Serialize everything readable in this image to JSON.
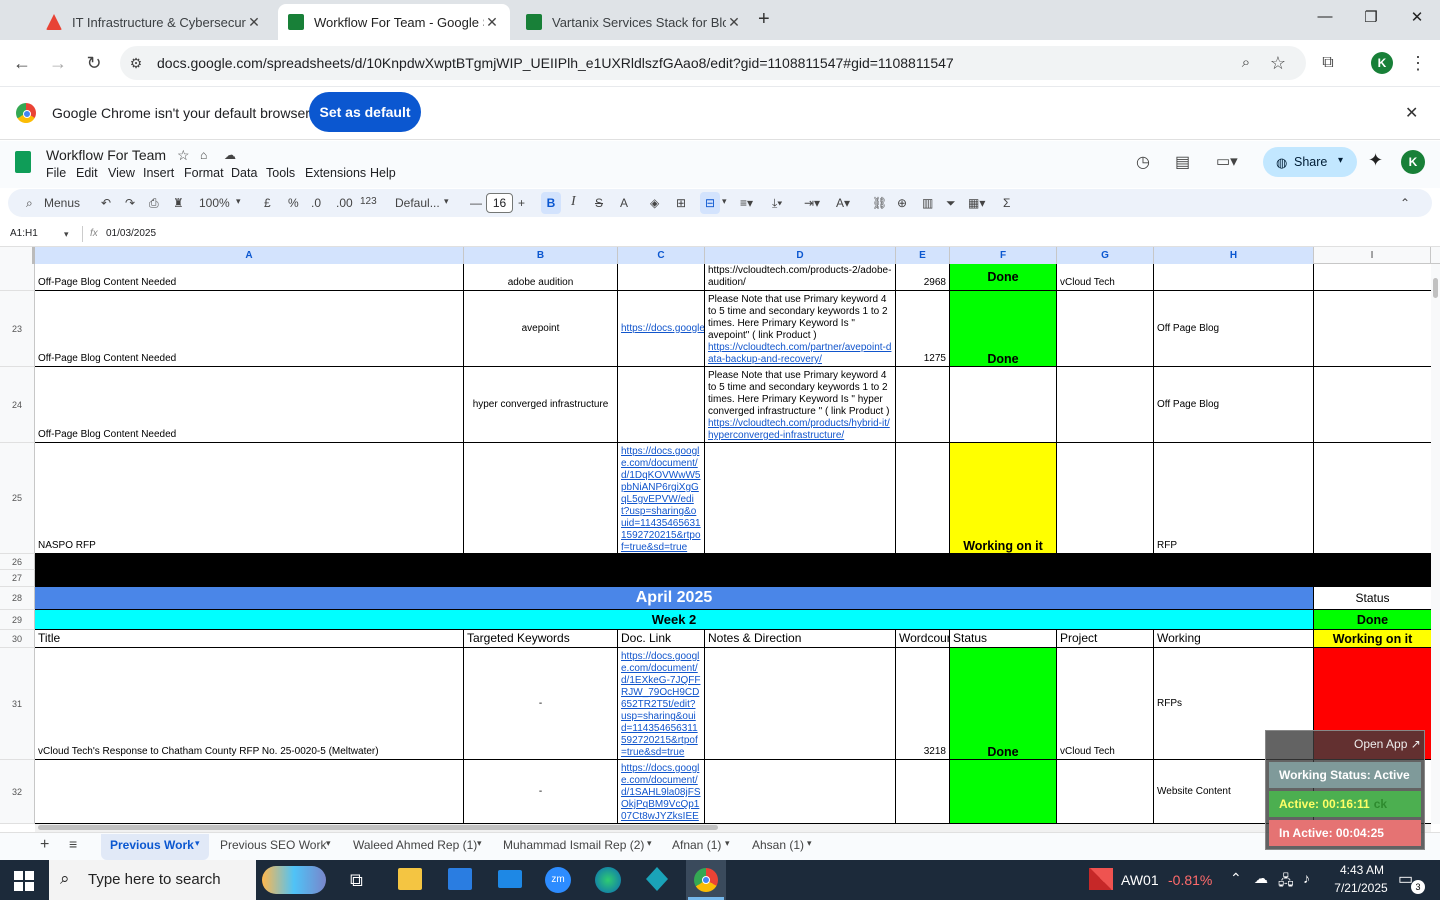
{
  "browser": {
    "tabs": [
      {
        "title": "IT Infrastructure & Cybersecurit",
        "favicon_color": "#e84335",
        "active": false
      },
      {
        "title": "Workflow For Team - Google Sh",
        "favicon_color": "#188038",
        "active": true
      },
      {
        "title": "Vartanix Services Stack for Blog",
        "favicon_color": "#188038",
        "active": false
      }
    ],
    "new_tab": "+",
    "url": "docs.google.com/spreadsheets/d/10KnpdwXwptBTgmjWIP_UEIIPlh_e1UXRldlszfGAao8/edit?gid=1108811547#gid=1108811547",
    "profile_initial": "K"
  },
  "infobar": {
    "message": "Google Chrome isn't your default browser",
    "button": "Set as default"
  },
  "sheets": {
    "doc_title": "Workflow For Team",
    "menus": [
      "File",
      "Edit",
      "View",
      "Insert",
      "Format",
      "Data",
      "Tools",
      "Extensions",
      "Help"
    ],
    "share": "Share",
    "toolbar": {
      "menus_search": "Menus",
      "zoom": "100%",
      "currency": "£",
      "percent": "%",
      "dec_dec": ".0",
      "dec_inc": ".00",
      "format_123": "123",
      "font": "Defaul...",
      "font_size": "16"
    },
    "name_box": "A1:H1",
    "fx_value": "01/03/2025",
    "columns": [
      "A",
      "B",
      "C",
      "D",
      "E",
      "F",
      "G",
      "H",
      "I"
    ],
    "rows": {
      "r22": {
        "a": "Off-Page Blog Content Needed",
        "b": "adobe audition",
        "d": "https://vcloudtech.com/products-2/adobe-audition/",
        "e": "2968",
        "f": "Done",
        "g": "vCloud Tech"
      },
      "r23": {
        "num": "23",
        "a": "Off-Page Blog Content Needed",
        "b": "avepoint",
        "c": "https://docs.google",
        "d_note": "Please Note that use Primary keyword 4 to 5 time and secondary keywords 1 to 2 times. Here Primary Keyword Is \" avepoint\" ( link Product )",
        "d_link": "https://vcloudtech.com/partner/avepoint-data-backup-and-recovery/",
        "e": "1275",
        "f": "Done",
        "h": "Off Page Blog"
      },
      "r24": {
        "num": "24",
        "a": "Off-Page Blog Content Needed",
        "b": "hyper converged infrastructure",
        "d_note": "Please Note that use Primary keyword 4 to 5 time and secondary keywords 1 to 2 times. Here Primary Keyword Is \" hyper converged infrastructure \" ( link Product )",
        "d_link": "https://vcloudtech.com/products/hybrid-it/hyperconverged-infrastructure/",
        "h": "Off Page Blog"
      },
      "r25": {
        "num": "25",
        "a": "NASPO RFP",
        "c": "https://docs.google.com/document/d/1DqKOVWwW5pbNiANP6rgiXgGqL5gvEPVW/edit?usp=sharing&ouid=114354656311592720215&rtpof=true&sd=true",
        "f": "Working on it",
        "h": "RFP"
      },
      "r26": {
        "num": "26"
      },
      "r27": {
        "num": "27"
      },
      "r28": {
        "num": "28",
        "month": "April 2025",
        "i": "Status"
      },
      "r29": {
        "num": "29",
        "week": "Week 2",
        "i": "Done"
      },
      "r30": {
        "num": "30",
        "headers": [
          "Title",
          "Targeted Keywords",
          "Doc. Link",
          "Notes & Direction",
          "Wordcour",
          "Status",
          "Project",
          "Working"
        ],
        "i": "Working on it"
      },
      "r31": {
        "num": "31",
        "a": "vCloud Tech's Response to Chatham County RFP No. 25-0020-5 (Meltwater)",
        "b": "-",
        "c": "https://docs.google.com/document/d/1EXkeG-7JQFFRJW_79OcH9CD652TR2T5t/edit?usp=sharing&ouid=114354656311592720215&rtpof=true&sd=true",
        "e": "3218",
        "f": "Done",
        "g": "vCloud Tech",
        "h": "RFPs"
      },
      "r32": {
        "num": "32",
        "b": "-",
        "c": "https://docs.google.com/document/d/1SAHL9la08jFSOkjPqBM9VcQp107Ct8wJYZksIEE",
        "h": "Website Content"
      }
    },
    "sheet_tabs": [
      "Previous Work",
      "Previous SEO Work",
      "Waleed Ahmed Rep (1)",
      "Muhammad Ismail Rep (2)",
      "Afnan (1)",
      "Ahsan (1)"
    ]
  },
  "widget": {
    "open_app": "Open App ↗",
    "working_status": "Working Status: Active",
    "active": "Active: 00:16:11",
    "inactive": "In Active: 00:04:25",
    "hidden_text": "ck"
  },
  "taskbar": {
    "search_placeholder": "Type here to search",
    "stock_name": "AW01",
    "stock_change": "-0.81%",
    "time": "4:43 AM",
    "date": "7/21/2025",
    "notifications": "3"
  },
  "colors": {
    "done": "#00ff00",
    "working": "#ffff00",
    "stuck": "#ff0000",
    "month_header": "#4a86e8",
    "week_header": "#00ffff"
  }
}
